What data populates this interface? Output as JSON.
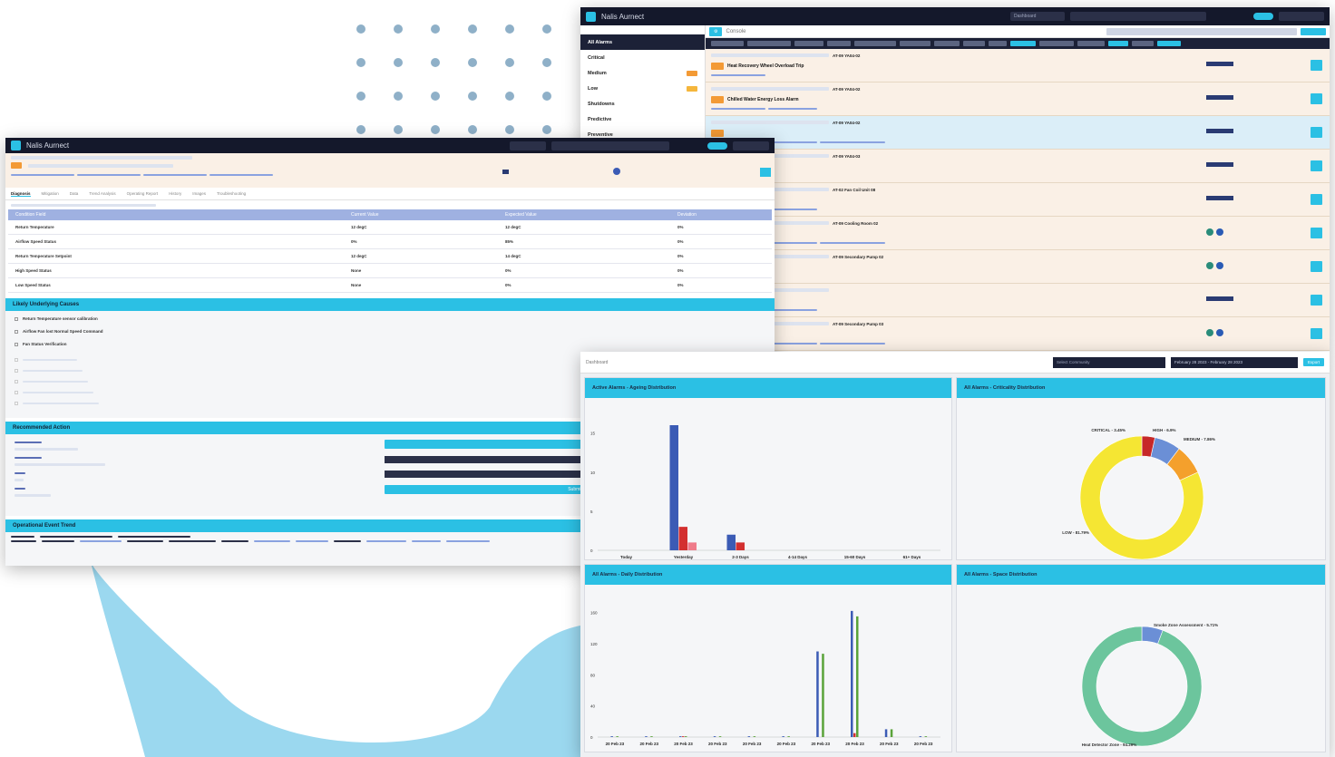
{
  "colors": {
    "accent": "#2bc0e4",
    "nav": "#14182b",
    "bar_blue": "#3b5bb5",
    "bar_red": "#d32f2f",
    "bar_pink": "#ef7b8a",
    "bar_green": "#5aa33a",
    "donut_yellow": "#f5e633",
    "donut_blue": "#6b8fd6",
    "donut_orange": "#f4a02c",
    "donut_red": "#c62828",
    "donut_green": "#6cc59d"
  },
  "alarms_window": {
    "brand": "Nalis Aurnect",
    "top_search": "Dashboard",
    "sidebar": [
      {
        "label": "All Alarms",
        "active": true
      },
      {
        "label": "Critical"
      },
      {
        "label": "Medium",
        "badge_color": "#f39a35"
      },
      {
        "label": "Low",
        "badge_color": "#f5b63c"
      },
      {
        "label": "Shutdowns"
      },
      {
        "label": "Predictive"
      },
      {
        "label": "Preventive"
      }
    ],
    "breadcrumb": "Console",
    "alarms": [
      {
        "title": "Heat Recovery Wheel Overload Trip",
        "tag": "AT-09 YA04-02"
      },
      {
        "title": "Chilled Water Energy Loss Alarm",
        "tag": "AT-09 YA04-02"
      },
      {
        "title": "",
        "tag": "AT-09 YA04-02"
      },
      {
        "title": "",
        "tag": "AT-09 YA04-03"
      },
      {
        "title": "",
        "tag": "AT-02 Fan Coil Unit 08"
      },
      {
        "title": "",
        "tag": "AT-09 Cooling Room 02"
      },
      {
        "title": "",
        "tag": "AT-09 Secondary Pump 02"
      },
      {
        "title": "",
        "tag": ""
      },
      {
        "title": "",
        "tag": "AT-09 Secondary Pump 03"
      }
    ]
  },
  "detail_window": {
    "brand": "Nalis Aurnect",
    "tabs": [
      "Diagnosis",
      "Mitigation",
      "Data",
      "Trend Analysis",
      "Operating Report",
      "History",
      "Images",
      "Troubleshooting"
    ],
    "table_headers": [
      "Condition Field",
      "Current Value",
      "Expected Value",
      "Deviation"
    ],
    "table_rows": [
      [
        "Return Temperature",
        "12 degC",
        "12 degC",
        "0%"
      ],
      [
        "Airflow Speed Status",
        "0%",
        "85%",
        "0%"
      ],
      [
        "Return Temperature Setpoint",
        "12 degC",
        "14 degC",
        "0%"
      ],
      [
        "High Speed Status",
        "None",
        "0%",
        "0%"
      ],
      [
        "Low Speed Status",
        "None",
        "0%",
        "0%"
      ]
    ],
    "section_causes": "Likely Underlying Causes",
    "causes": [
      "Return Temperature sensor calibration",
      "Airflow Fan lost Normal Speed Command",
      "Fan Status Verification"
    ],
    "section_actions": "Recommended Action",
    "section_history": "Operational Event Trend",
    "action_button": "Submit"
  },
  "dashboard": {
    "breadcrumb": "Dashboard",
    "date_range": "February 28 2023 - February 28 2023",
    "export": "Export",
    "select_placeholder": "Select Community",
    "chart_titles": [
      "Active Alarms - Ageing Distribution",
      "All Alarms - Criticality Distribution",
      "All Alarms - Daily Distribution",
      "All Alarms - Space Distribution"
    ]
  },
  "chart_data": [
    {
      "type": "bar",
      "categories": [
        "Today",
        "Yesterday",
        "2-3 Days",
        "4-14 Days",
        "15-60 Days",
        "61+ Days"
      ],
      "series": [
        {
          "values": [
            0,
            16,
            2,
            0,
            0,
            0
          ]
        },
        {
          "values": [
            0,
            3,
            1,
            0,
            0,
            0
          ]
        },
        {
          "values": [
            0,
            1,
            0,
            0,
            0,
            0
          ]
        }
      ],
      "yticks": [
        "0",
        "5",
        "10",
        "15"
      ],
      "ylim": [
        0,
        16
      ]
    },
    {
      "type": "pie",
      "labels": [
        "CRITICAL - 3.45%",
        "HIGH - 6.9%",
        "MEDIUM - 7.86%",
        "LOW - 81.79%"
      ],
      "values": [
        3.45,
        6.9,
        7.86,
        81.79
      ]
    },
    {
      "type": "bar",
      "categories": [
        "20 Feb 23",
        "20 Feb 23",
        "20 Feb 23",
        "20 Feb 23",
        "20 Feb 23",
        "20 Feb 23",
        "20 Feb 23",
        "20 Feb 23",
        "20 Feb 23",
        "20 Feb 23"
      ],
      "series": [
        {
          "values": [
            1,
            1,
            1,
            1,
            1,
            1,
            110,
            162,
            10,
            1
          ]
        },
        {
          "values": [
            0,
            0,
            1,
            0,
            0,
            0,
            0,
            5,
            0,
            0
          ]
        },
        {
          "values": [
            1,
            1,
            1,
            1,
            1,
            1,
            107,
            155,
            10,
            1
          ]
        }
      ],
      "yticks": [
        "0",
        "40",
        "80",
        "120",
        "160"
      ],
      "ylim": [
        0,
        170
      ]
    },
    {
      "type": "pie",
      "labels": [
        "Smoke Zone Assessment - 5.71%",
        "Heat Detector Zone - 94.29%"
      ],
      "values": [
        5.71,
        94.29
      ]
    }
  ]
}
